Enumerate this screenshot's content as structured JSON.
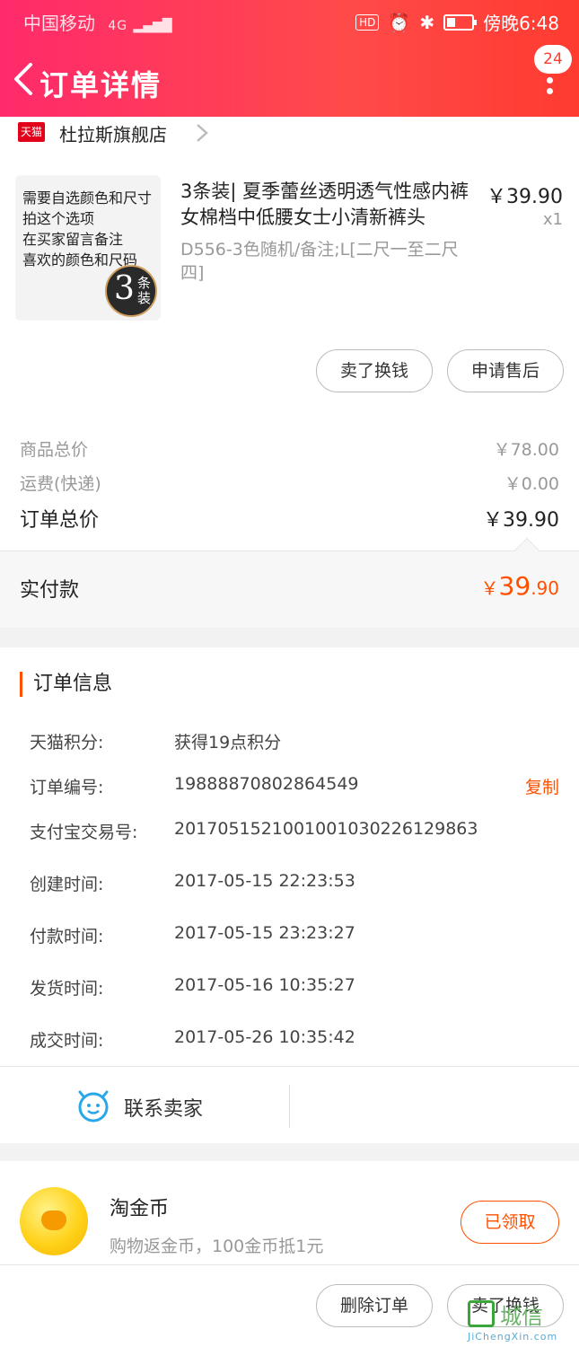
{
  "status_bar": {
    "carrier": "中国移动",
    "network": "4G",
    "hd": "HD",
    "battery": "17",
    "time": "傍晚6:48"
  },
  "header": {
    "title": "订单详情",
    "badge": "24"
  },
  "store": {
    "tmall_label": "天猫",
    "name": "杜拉斯旗舰店"
  },
  "product": {
    "image_text": "需要自选颜色和尺寸\n拍这个选项\n在买家留言备注\n喜欢的颜色和尺码",
    "image_seal_number": "3",
    "image_seal_text": "条装",
    "title": "3条装| 夏季蕾丝透明透气性感内裤女棉档中低腰女士小清新裤头",
    "sku": "D556-3色随机/备注;L[二尺一至二尺四]",
    "price": "￥39.90",
    "qty": "x1",
    "buttons": [
      "卖了换钱",
      "申请售后"
    ]
  },
  "summary": {
    "goods_label": "商品总价",
    "goods_value": "￥78.00",
    "shipping_label": "运费(快递)",
    "shipping_value": "￥0.00",
    "total_label": "订单总价",
    "total_value": "￥39.90",
    "paid_label": "实付款",
    "paid_currency": "￥",
    "paid_int": "39",
    "paid_dec": ".90"
  },
  "order_info": {
    "title": "订单信息",
    "rows": [
      {
        "key": "天猫积分:",
        "value": "获得19点积分",
        "action": ""
      },
      {
        "key": "订单编号:",
        "value": "19888870802864549",
        "action": "复制"
      },
      {
        "key": "支付宝交易号:",
        "value": "2017051521001001030226129863",
        "action": ""
      },
      {
        "key": "创建时间:",
        "value": "2017-05-15 22:23:53",
        "action": ""
      },
      {
        "key": "付款时间:",
        "value": "2017-05-15 23:23:27",
        "action": ""
      },
      {
        "key": "发货时间:",
        "value": "2017-05-16 10:35:27",
        "action": ""
      },
      {
        "key": "成交时间:",
        "value": "2017-05-26 10:35:42",
        "action": ""
      }
    ],
    "contact_label": "联系卖家"
  },
  "coin": {
    "title": "淘金币",
    "subtitle": "购物返金币，100金币抵1元",
    "button": "已领取"
  },
  "bottom_bar": {
    "buttons": [
      "删除订单",
      "卖了换钱"
    ]
  },
  "watermark": {
    "text": "城信",
    "url": "JiChengXin.com"
  },
  "colors": {
    "header_start": "#ff2a6b",
    "header_end": "#ff3b30",
    "accent": "#ff5000"
  }
}
